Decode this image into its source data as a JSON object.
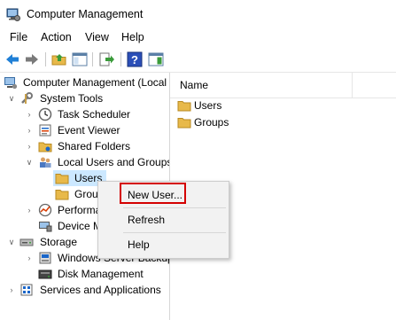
{
  "window": {
    "title": "Computer Management",
    "icon": "computer-management-icon"
  },
  "menu": [
    "File",
    "Action",
    "View",
    "Help"
  ],
  "toolbar": {
    "buttons": [
      "back-icon",
      "forward-icon",
      "up-folder-icon",
      "show-hide-console-tree-icon",
      "export-list-icon",
      "help-icon",
      "show-hide-action-pane-icon"
    ]
  },
  "tree": {
    "root": "Computer Management (Local",
    "system_tools": "System Tools",
    "task_scheduler": "Task Scheduler",
    "event_viewer": "Event Viewer",
    "shared_folders": "Shared Folders",
    "local_users_groups": "Local Users and Groups",
    "users": "Users",
    "groups": "Groups",
    "performance": "Performance",
    "device_manager": "Device Manager",
    "storage": "Storage",
    "windows_server_backup": "Windows Server Backup",
    "disk_management": "Disk Management",
    "services_applications": "Services and Applications"
  },
  "list": {
    "column_name": "Name",
    "items": [
      "Users",
      "Groups"
    ]
  },
  "context_menu": {
    "new_user": "New User...",
    "refresh": "Refresh",
    "help": "Help",
    "highlight_color": "#d40000"
  },
  "colors": {
    "selection": "#cce8ff",
    "folder": "#e8b94a",
    "accent_blue": "#1a66c9"
  }
}
